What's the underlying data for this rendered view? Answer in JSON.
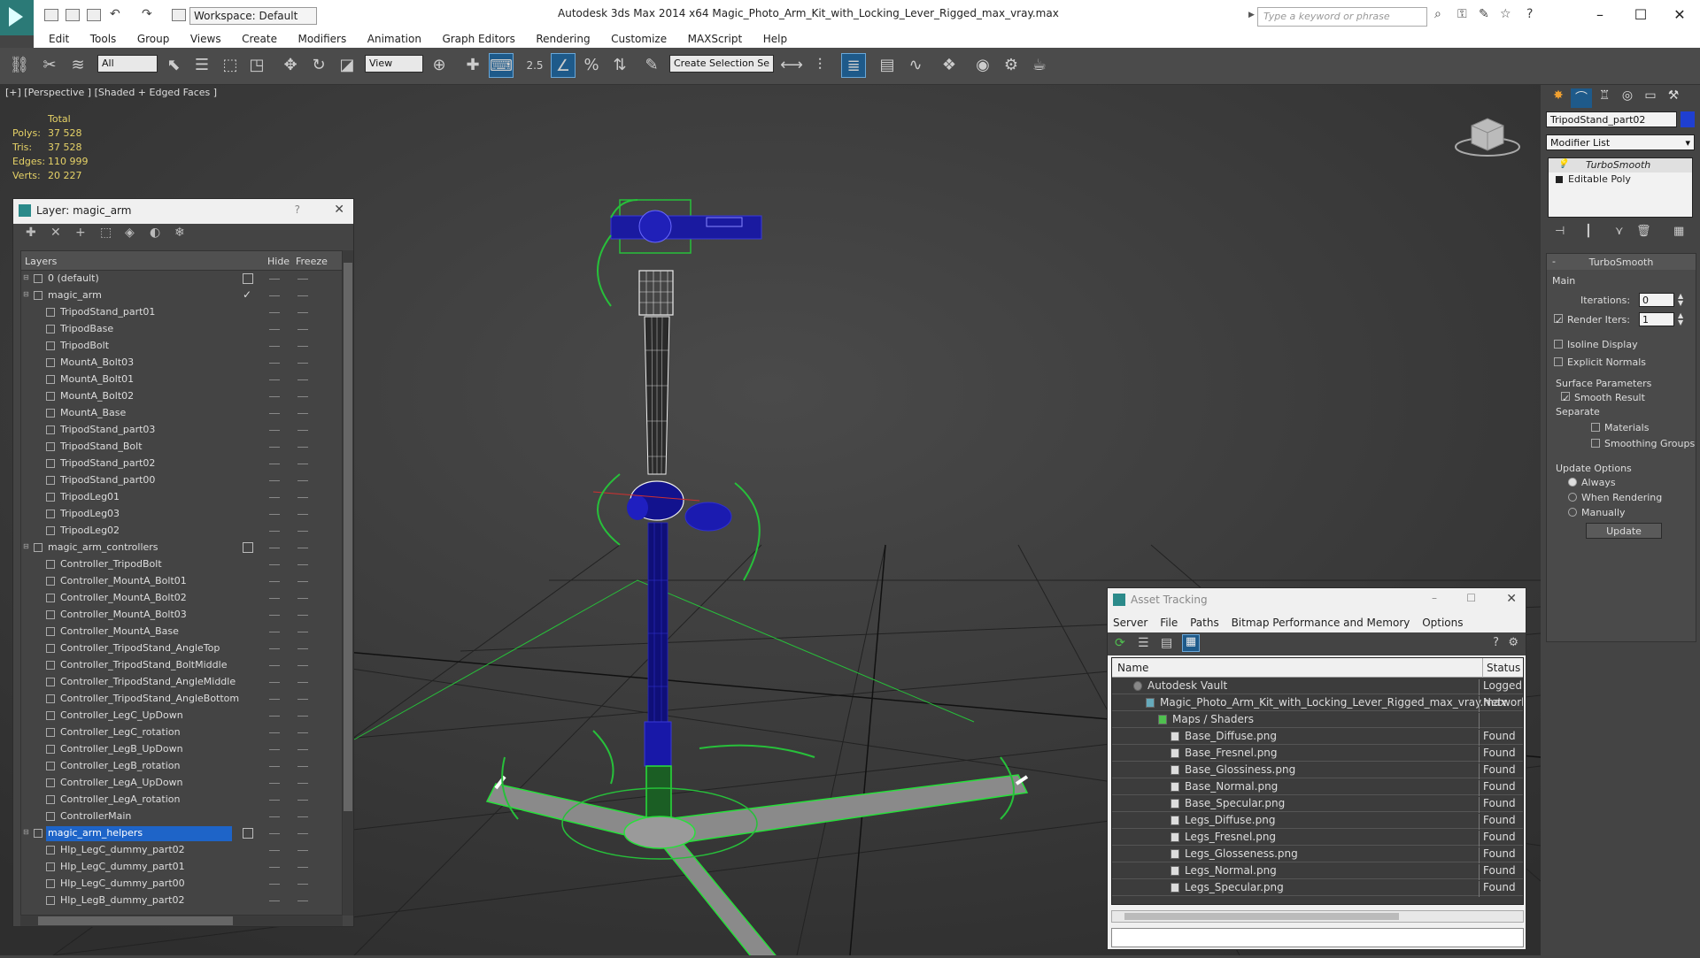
{
  "app": {
    "workspace": "Workspace: Default",
    "title": "Autodesk 3ds Max  2014 x64      Magic_Photo_Arm_Kit_with_Locking_Lever_Rigged_max_vray.max",
    "search_placeholder": "Type a keyword or phrase"
  },
  "menu": [
    "Edit",
    "Tools",
    "Group",
    "Views",
    "Create",
    "Modifiers",
    "Animation",
    "Graph Editors",
    "Rendering",
    "Customize",
    "MAXScript",
    "Help"
  ],
  "toolbar": {
    "filter": "All",
    "refcoord": "View",
    "selection_set": "Create Selection Se"
  },
  "viewport": {
    "label": "[+] [Perspective ] [Shaded + Edged Faces ]",
    "stats": {
      "header": "Total",
      "rows": [
        {
          "label": "Polys:",
          "value": "37 528"
        },
        {
          "label": "Tris:",
          "value": "37 528"
        },
        {
          "label": "Edges:",
          "value": "110 999"
        },
        {
          "label": "Verts:",
          "value": "20 227"
        }
      ]
    }
  },
  "layer_panel": {
    "title": "Layer: magic_arm",
    "help": "?",
    "columns": {
      "layers": "Layers",
      "hide": "Hide",
      "freeze": "Freeze"
    },
    "rows": [
      {
        "name": "0 (default)",
        "level": 0,
        "type": "layer",
        "mark": "box"
      },
      {
        "name": "magic_arm",
        "level": 0,
        "type": "layer",
        "mark": "tick"
      },
      {
        "name": "TripodStand_part01",
        "level": 1,
        "type": "object"
      },
      {
        "name": "TripodBase",
        "level": 1,
        "type": "object"
      },
      {
        "name": "TripodBolt",
        "level": 1,
        "type": "object"
      },
      {
        "name": "MountA_Bolt03",
        "level": 1,
        "type": "object"
      },
      {
        "name": "MountA_Bolt01",
        "level": 1,
        "type": "object"
      },
      {
        "name": "MountA_Bolt02",
        "level": 1,
        "type": "object"
      },
      {
        "name": "MountA_Base",
        "level": 1,
        "type": "object"
      },
      {
        "name": "TripodStand_part03",
        "level": 1,
        "type": "object"
      },
      {
        "name": "TripodStand_Bolt",
        "level": 1,
        "type": "object"
      },
      {
        "name": "TripodStand_part02",
        "level": 1,
        "type": "object"
      },
      {
        "name": "TripodStand_part00",
        "level": 1,
        "type": "object"
      },
      {
        "name": "TripodLeg01",
        "level": 1,
        "type": "object"
      },
      {
        "name": "TripodLeg03",
        "level": 1,
        "type": "object"
      },
      {
        "name": "TripodLeg02",
        "level": 1,
        "type": "object"
      },
      {
        "name": "magic_arm_controllers",
        "level": 0,
        "type": "layer",
        "mark": "box"
      },
      {
        "name": "Controller_TripodBolt",
        "level": 1,
        "type": "object"
      },
      {
        "name": "Controller_MountA_Bolt01",
        "level": 1,
        "type": "object"
      },
      {
        "name": "Controller_MountA_Bolt02",
        "level": 1,
        "type": "object"
      },
      {
        "name": "Controller_MountA_Bolt03",
        "level": 1,
        "type": "object"
      },
      {
        "name": "Controller_MountA_Base",
        "level": 1,
        "type": "object"
      },
      {
        "name": "Controller_TripodStand_AngleTop",
        "level": 1,
        "type": "object"
      },
      {
        "name": "Controller_TripodStand_BoltMiddle",
        "level": 1,
        "type": "object"
      },
      {
        "name": "Controller_TripodStand_AngleMiddle",
        "level": 1,
        "type": "object"
      },
      {
        "name": "Controller_TripodStand_AngleBottom",
        "level": 1,
        "type": "object"
      },
      {
        "name": "Controller_LegC_UpDown",
        "level": 1,
        "type": "object"
      },
      {
        "name": "Controller_LegC_rotation",
        "level": 1,
        "type": "object"
      },
      {
        "name": "Controller_LegB_UpDown",
        "level": 1,
        "type": "object"
      },
      {
        "name": "Controller_LegB_rotation",
        "level": 1,
        "type": "object"
      },
      {
        "name": "Controller_LegA_UpDown",
        "level": 1,
        "type": "object"
      },
      {
        "name": "Controller_LegA_rotation",
        "level": 1,
        "type": "object"
      },
      {
        "name": "ControllerMain",
        "level": 1,
        "type": "object"
      },
      {
        "name": "magic_arm_helpers",
        "level": 0,
        "type": "layer",
        "mark": "box",
        "selected": true
      },
      {
        "name": "Hlp_LegC_dummy_part02",
        "level": 1,
        "type": "object"
      },
      {
        "name": "Hlp_LegC_dummy_part01",
        "level": 1,
        "type": "object"
      },
      {
        "name": "Hlp_LegC_dummy_part00",
        "level": 1,
        "type": "object"
      },
      {
        "name": "Hlp_LegB_dummy_part02",
        "level": 1,
        "type": "object"
      }
    ]
  },
  "command_panel": {
    "object_name": "TripodStand_part02",
    "object_color": "#1f3fd1",
    "modifier_list": "Modifier List",
    "stack": [
      {
        "name": "TurboSmooth",
        "active": true
      },
      {
        "name": "Editable Poly",
        "active": false
      }
    ],
    "rollout_title": "TurboSmooth",
    "main": {
      "label": "Main",
      "iterations_label": "Iterations:",
      "iterations": "0",
      "render_iters_label": "Render Iters:",
      "render_iters": "1",
      "isoline": "Isoline Display",
      "explicit": "Explicit Normals"
    },
    "surface": {
      "label": "Surface Parameters",
      "smooth_result": "Smooth Result",
      "separate": "Separate",
      "materials": "Materials",
      "smoothing_groups": "Smoothing Groups"
    },
    "update": {
      "label": "Update Options",
      "always": "Always",
      "when_rendering": "When Rendering",
      "manually": "Manually",
      "button": "Update"
    }
  },
  "asset_tracking": {
    "title": "Asset Tracking",
    "menu": [
      "Server",
      "File",
      "Paths",
      "Bitmap Performance and Memory",
      "Options"
    ],
    "columns": {
      "name": "Name",
      "status": "Status"
    },
    "rows": [
      {
        "name": "Autodesk Vault",
        "status": "Logged O",
        "indent": 1,
        "icon": "vault"
      },
      {
        "name": "Magic_Photo_Arm_Kit_with_Locking_Lever_Rigged_max_vray.max",
        "status": "Network",
        "indent": 2,
        "icon": "max"
      },
      {
        "name": "Maps / Shaders",
        "status": "",
        "indent": 3,
        "icon": "folder"
      },
      {
        "name": "Base_Diffuse.png",
        "status": "Found",
        "indent": 4,
        "icon": "file"
      },
      {
        "name": "Base_Fresnel.png",
        "status": "Found",
        "indent": 4,
        "icon": "file"
      },
      {
        "name": "Base_Glossiness.png",
        "status": "Found",
        "indent": 4,
        "icon": "file"
      },
      {
        "name": "Base_Normal.png",
        "status": "Found",
        "indent": 4,
        "icon": "file"
      },
      {
        "name": "Base_Specular.png",
        "status": "Found",
        "indent": 4,
        "icon": "file"
      },
      {
        "name": "Legs_Diffuse.png",
        "status": "Found",
        "indent": 4,
        "icon": "file"
      },
      {
        "name": "Legs_Fresnel.png",
        "status": "Found",
        "indent": 4,
        "icon": "file"
      },
      {
        "name": "Legs_Glosseness.png",
        "status": "Found",
        "indent": 4,
        "icon": "file"
      },
      {
        "name": "Legs_Normal.png",
        "status": "Found",
        "indent": 4,
        "icon": "file"
      },
      {
        "name": "Legs_Specular.png",
        "status": "Found",
        "indent": 4,
        "icon": "file"
      }
    ]
  }
}
